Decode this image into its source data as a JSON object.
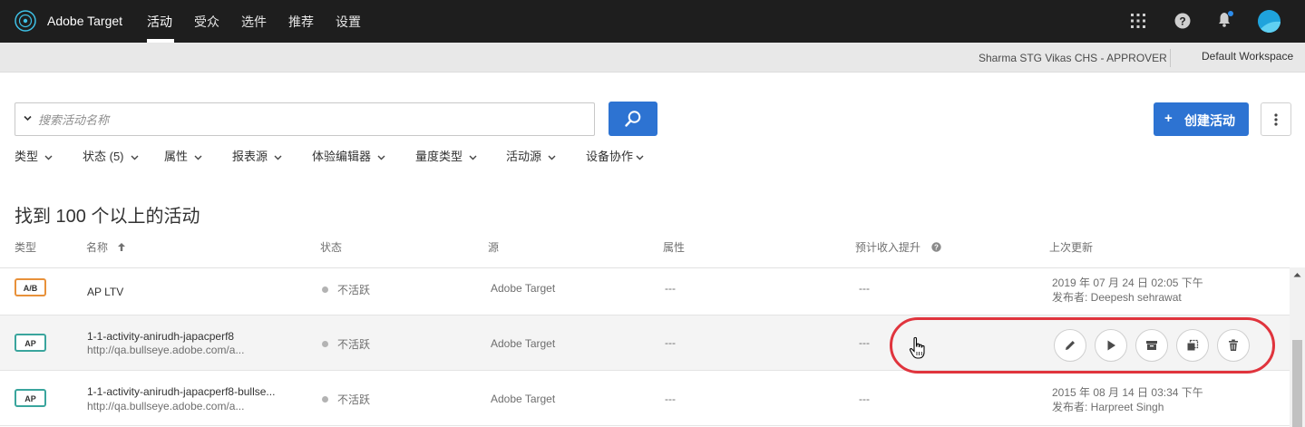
{
  "app": {
    "brand": "Adobe Target",
    "nav": [
      {
        "label": "活动",
        "active": true
      },
      {
        "label": "受众"
      },
      {
        "label": "选件"
      },
      {
        "label": "推荐"
      },
      {
        "label": "设置"
      }
    ],
    "icons": [
      "apps-grid-icon",
      "help-icon",
      "notification-bell-icon",
      "profile-avatar-icon"
    ]
  },
  "workspace_bar": {
    "user": "Sharma STG Vikas CHS - APPROVER",
    "workspace": "Default Workspace"
  },
  "search": {
    "placeholder": "搜索活动名称"
  },
  "create_button": {
    "plus": "+",
    "label": "创建活动"
  },
  "filters": [
    "类型",
    "状态 (5)",
    "属性",
    "报表源",
    "体验编辑器",
    "量度类型",
    "活动源",
    "设备协作"
  ],
  "results_title": "找到 100 个以上的活动",
  "table": {
    "headers": {
      "type": "类型",
      "name": "名称",
      "status": "状态",
      "source": "源",
      "property": "属性",
      "lift": "预计收入提升",
      "updated": "上次更新"
    },
    "rows": [
      {
        "type": "A/B",
        "name": "AP LTV",
        "url": "",
        "status": "不活跃",
        "source": "Adobe Target",
        "property": "---",
        "lift": "---",
        "updated": "2019 年 07 月 24 日 02:05 下午",
        "publisher": "发布者: Deepesh sehrawat"
      },
      {
        "type": "AP",
        "name": "1-1-activity-anirudh-japacperf8",
        "url": "http://qa.bullseye.adobe.com/a...",
        "status": "不活跃",
        "source": "Adobe Target",
        "property": "---",
        "lift": "---",
        "updated": "",
        "publisher": ""
      },
      {
        "type": "AP",
        "name": "1-1-activity-anirudh-japacperf8-bullse...",
        "url": "http://qa.bullseye.adobe.com/a...",
        "status": "不活跃",
        "source": "Adobe Target",
        "property": "---",
        "lift": "---",
        "updated": "2015 年 08 月 14 日 03:34 下午",
        "publisher": "发布者: Harpreet Singh"
      }
    ]
  },
  "row_actions": [
    "edit-icon",
    "activate-icon",
    "archive-icon",
    "copy-icon",
    "delete-icon"
  ],
  "colors": {
    "nav_bg": "#1e1e1e",
    "primary_blue": "#2d73d2",
    "ab_badge": "#e8913a",
    "ap_badge": "#3aa59d",
    "highlight_ring": "#e0343d"
  }
}
